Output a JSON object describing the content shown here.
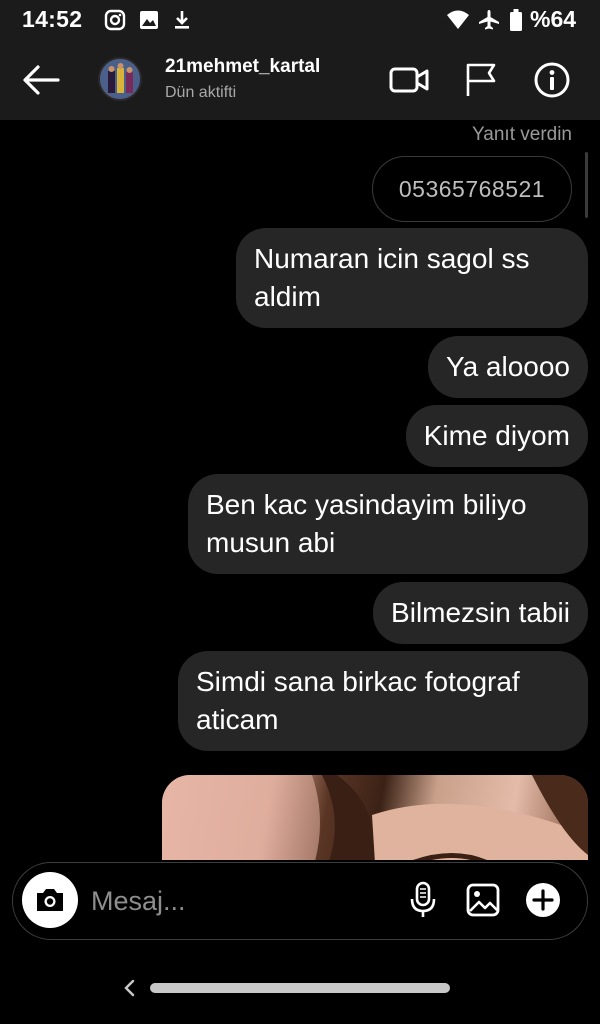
{
  "status_bar": {
    "time": "14:52",
    "battery": "%64",
    "icons": [
      "instagram-icon",
      "image-icon",
      "download-icon",
      "wifi-icon",
      "airplane-icon",
      "battery-icon"
    ]
  },
  "header": {
    "contact_name": "21mehmet_kartal",
    "contact_status": "Dün aktifti",
    "icons": [
      "back-arrow-icon",
      "video-call-icon",
      "flag-icon",
      "info-icon"
    ]
  },
  "conversation": {
    "replied_label": "Yanıt verdin",
    "replied_to_text": "05365768521",
    "messages": [
      {
        "text": "Numaran icin sagol ss aldim"
      },
      {
        "text": "Ya aloooo"
      },
      {
        "text": "Kime diyom"
      },
      {
        "text": "Ben kac yasindayim biliyo musun abi"
      },
      {
        "text": "Bilmezsin tabii"
      },
      {
        "text": "Simdi sana birkac fotograf aticam"
      }
    ]
  },
  "composer": {
    "placeholder": "Mesaj...",
    "icons": [
      "camera-icon",
      "microphone-icon",
      "gallery-icon",
      "plus-icon"
    ]
  },
  "colors": {
    "background": "#000000",
    "bar": "#1b1b1b",
    "bubble": "#262626",
    "muted_text": "#a8a8a8"
  }
}
